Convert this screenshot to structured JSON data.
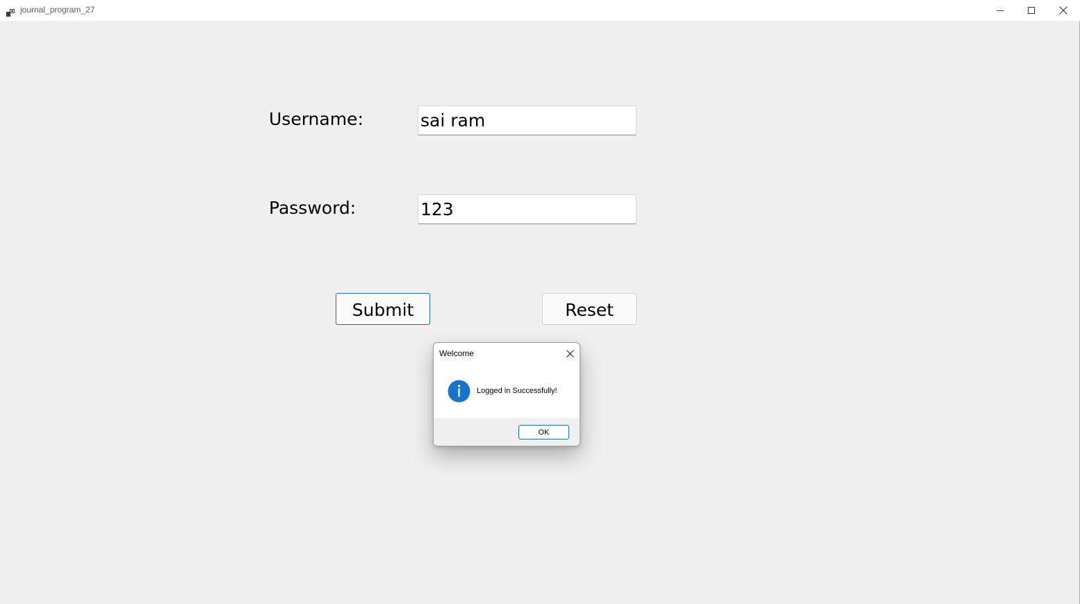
{
  "window": {
    "title": "journal_program_27"
  },
  "form": {
    "username_label": "Username:",
    "username_value": "sai ram",
    "password_label": "Password:",
    "password_value": "123",
    "submit_label": "Submit",
    "reset_label": "Reset"
  },
  "dialog": {
    "title": "Welcome",
    "message": "Logged in Successfully!",
    "ok_label": "OK",
    "icon": "info-icon"
  },
  "colors": {
    "accent": "#0067c0",
    "info_icon": "#1a73c9",
    "background": "#f0f0f0"
  }
}
